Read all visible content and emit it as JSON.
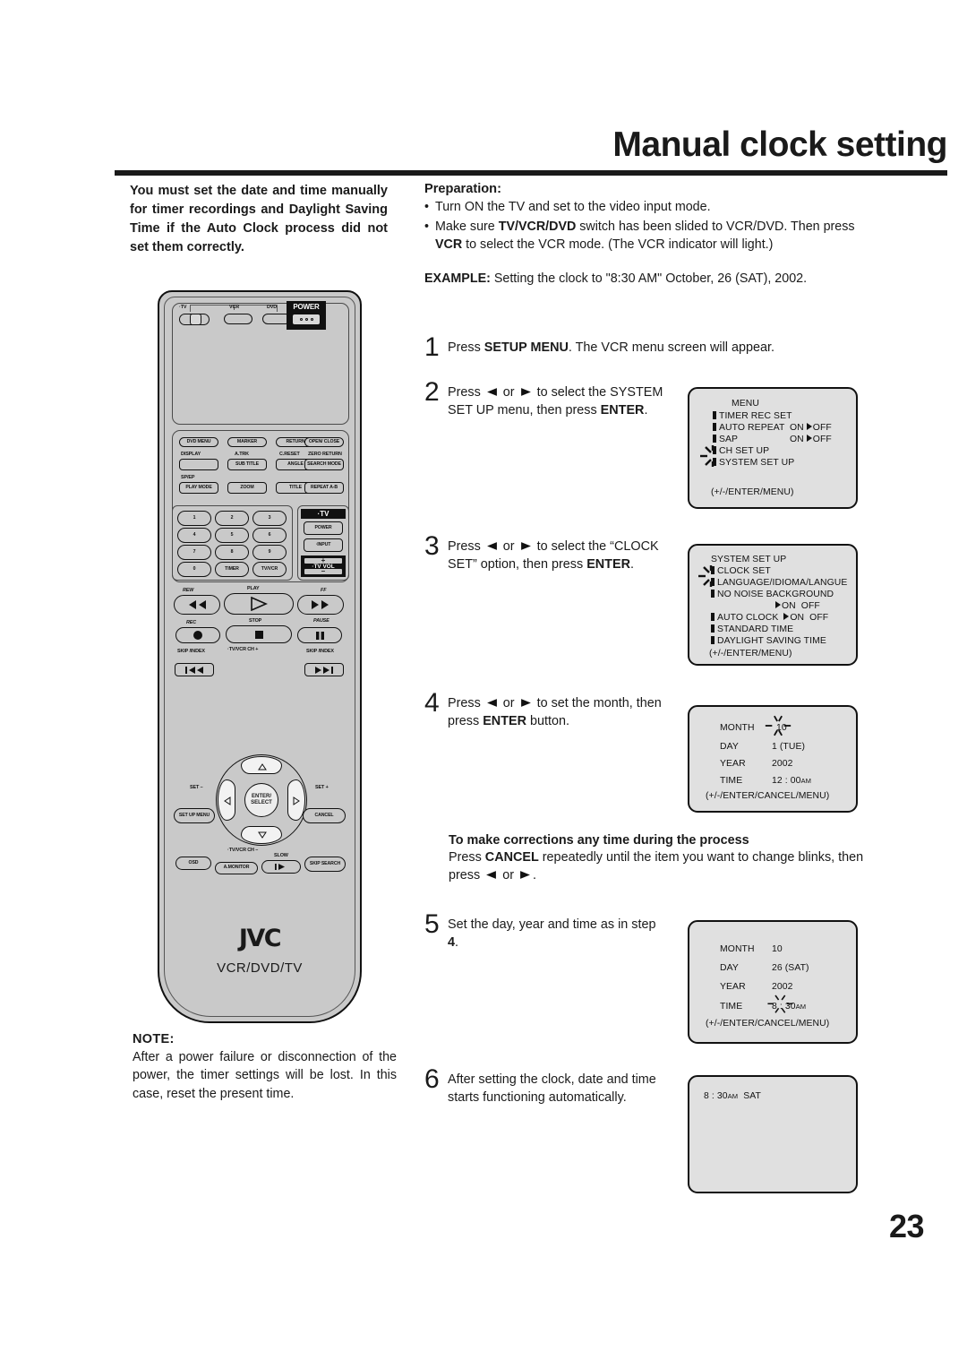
{
  "page": {
    "title": "Manual clock setting",
    "number": "23"
  },
  "intro": "You must set the date and time manually for timer recordings and Daylight Saving Time if the Auto Clock process did not set them correctly.",
  "note": {
    "heading": "NOTE:",
    "body": "After a power failure or disconnection of the power, the timer settings will be lost. In this case, reset the present time."
  },
  "preparation": {
    "heading": "Preparation:",
    "item1": "Turn ON the TV and set to the video input mode.",
    "item2_a": "Make sure ",
    "item2_b": "TV/VCR/DVD",
    "item2_c": " switch has been slided to VCR/DVD. Then press ",
    "item2_d": "VCR",
    "item2_e": " to select the VCR mode. (The VCR indicator will light.)"
  },
  "example": {
    "label": "EXAMPLE:",
    "text": " Setting the clock to \"8:30 AM\" October, 26 (SAT), 2002."
  },
  "steps": {
    "s1": {
      "num": "1",
      "a": "Press ",
      "b": "SETUP MENU",
      "c": ". The VCR menu screen will appear."
    },
    "s2": {
      "num": "2",
      "a": "Press ",
      "or": " or ",
      "b": " to select the SYSTEM SET UP menu, then press ",
      "c": "ENTER",
      "d": "."
    },
    "s3": {
      "num": "3",
      "a": "Press ",
      "or": " or ",
      "b": " to select the “CLOCK SET” option, then press ",
      "c": "ENTER",
      "d": "."
    },
    "s4": {
      "num": "4",
      "a": "Press ",
      "or": " or ",
      "b": " to set the month, then press ",
      "c": "ENTER",
      "d": " button."
    },
    "s5": {
      "num": "5",
      "a": "Set the day, year and time as in step ",
      "b": "4",
      "c": "."
    },
    "s6": {
      "num": "6",
      "a": "After setting the clock, date and time starts functioning automatically."
    }
  },
  "corrections": {
    "heading": "To make corrections any time during the process",
    "a": "Press ",
    "b": "CANCEL",
    "c": " repeatedly until the item you want to change blinks, then press ",
    "or": " or ",
    "d": "."
  },
  "osd": {
    "menu": {
      "title": "MENU",
      "rows": [
        {
          "label": "TIMER REC SET",
          "value": ""
        },
        {
          "label": "AUTO REPEAT",
          "on": "ON",
          "off": "OFF"
        },
        {
          "label": "SAP",
          "on": "ON",
          "off": "OFF"
        },
        {
          "label": "CH SET UP",
          "value": ""
        },
        {
          "label": "SYSTEM SET UP",
          "value": ""
        }
      ],
      "footer": "(+/-/ENTER/MENU)"
    },
    "system": {
      "title": "SYSTEM SET UP",
      "rows": [
        {
          "label": "CLOCK SET"
        },
        {
          "label": "LANGUAGE/IDIOMA/LANGUE"
        },
        {
          "label": "NO NOISE BACKGROUND"
        }
      ],
      "nnb_on": "ON",
      "nnb_off": "OFF",
      "auto_clock": "AUTO CLOCK",
      "ac_on": "ON",
      "ac_off": "OFF",
      "standard": "STANDARD TIME",
      "daylight": "DAYLIGHT SAVING TIME",
      "footer": "(+/-/ENTER/MENU)"
    },
    "clock_initial": {
      "month_label": "MONTH",
      "month_value": "10",
      "day_label": "DAY",
      "day_value": "1 (TUE)",
      "year_label": "YEAR",
      "year_value": "2002",
      "time_label": "TIME",
      "time_value": "12 : 00",
      "time_suffix": "AM",
      "footer": "(+/-/ENTER/CANCEL/MENU)"
    },
    "clock_set": {
      "month_label": "MONTH",
      "month_value": "10",
      "day_label": "DAY",
      "day_value": "26 (SAT)",
      "year_label": "YEAR",
      "year_value": "2002",
      "time_label": "TIME",
      "time_value": "8 : 30",
      "time_suffix": "AM",
      "footer": "(+/-/ENTER/CANCEL/MENU)"
    },
    "clock_display": {
      "time": "8 : 30",
      "suffix": "AM",
      "day": "SAT"
    }
  },
  "remote": {
    "brand": "JVC",
    "subtitle": "VCR/DVD/TV",
    "switch": {
      "tv": "·TV",
      "vcr": "VCR",
      "dvd": "DVD"
    },
    "power": "POWER",
    "row1": [
      "DVD MENU",
      "MARKER",
      "RETURN",
      "OPEN/ CLOSE"
    ],
    "row2_labels": [
      "DISPLAY",
      "A.TRK",
      "C.RESET",
      "ZERO RETURN"
    ],
    "row2_buttons": [
      "",
      "SUB TITLE",
      "ANGLE",
      "SEARCH MODE"
    ],
    "row3_label": "SP/EP",
    "row3_buttons": [
      "PLAY MODE",
      "ZOOM",
      "TITLE",
      "REPEAT A-B"
    ],
    "numbers": [
      "1",
      "2",
      "3",
      "4",
      "5",
      "6",
      "7",
      "8",
      "9",
      "0"
    ],
    "timer": "TIMER",
    "tvvcr": "TV/VCR",
    "tv_strip": "·TV",
    "tv_power": "POWER",
    "tv_input": "·INPUT",
    "tv_vol": "·TV VOL",
    "vol_plus": "+",
    "vol_minus": "–",
    "transport": {
      "rew": "REW",
      "play": "PLAY",
      "ff": "FF",
      "rec": "REC",
      "stop": "STOP",
      "pause": "PAUSE"
    },
    "skip_index_left": "SKIP /INDEX",
    "skip_index_right": "SKIP /INDEX",
    "ch_up": "·TV/VCR CH +",
    "ch_down": "·TV/VCR CH –",
    "set_minus": "SET –",
    "set_plus": "SET +",
    "enter_select": "ENTER/ SELECT",
    "setup_menu": "SET UP MENU",
    "cancel": "CANCEL",
    "osd": "OSD",
    "amonitor": "A.MONITOR",
    "slow": "SLOW",
    "skip_search": "SKIP SEARCH"
  }
}
